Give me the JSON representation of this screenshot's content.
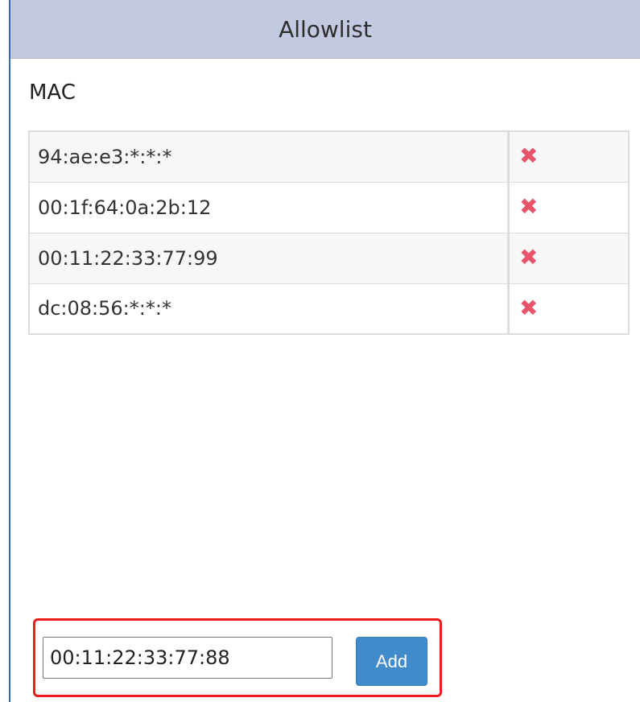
{
  "header": {
    "title": "Allowlist"
  },
  "section": {
    "label": "MAC"
  },
  "mac_list": [
    {
      "address": "94:ae:e3:*:*:*",
      "remove_icon": "✖"
    },
    {
      "address": "00:1f:64:0a:2b:12",
      "remove_icon": "✖"
    },
    {
      "address": "00:11:22:33:77:99",
      "remove_icon": "✖"
    },
    {
      "address": "dc:08:56:*:*:*",
      "remove_icon": "✖"
    }
  ],
  "add_form": {
    "input_value": "00:11:22:33:77:88",
    "button_label": "Add"
  },
  "colors": {
    "header_bg": "#c2c9e1",
    "remove_icon": "#e8556b",
    "button_bg": "#428bca",
    "highlight_border": "#ee1c1c"
  },
  "icons": {
    "remove": "close-icon"
  }
}
